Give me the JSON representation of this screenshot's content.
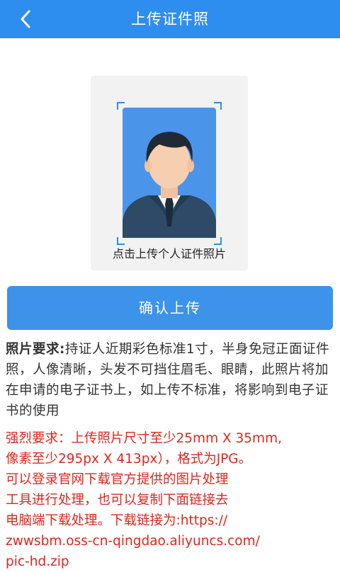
{
  "header": {
    "title": "上传证件照",
    "back_icon": "chevron-left-icon",
    "bg_color": "#2e8ef0"
  },
  "photo_card": {
    "caption": "点击上传个人证件照片",
    "portrait_icon": "person-portrait-icon",
    "portrait_bg_color": "#4a95ea"
  },
  "confirm_button": {
    "label": "确认上传",
    "color": "#3d92ea"
  },
  "requirements": {
    "label": "照片要求:",
    "text": "持证人近期彩色标准1寸，半身免冠正面证件照，人像清晰，头发不可挡住眉毛、眼睛，此照片将加在申请的电子证书上，如上传不标准，将影响到电子证书的使用"
  },
  "strong_requirements": {
    "color": "#e0261c",
    "lines": [
      "强烈要求：上传照片尺寸至少25mm X 35mm,",
      "像素至少295px X 413px），格式为JPG。",
      "可以登录官网下载官方提供的图片处理",
      "工具进行处理，也可以复制下面链接去",
      "电脑端下载处理。下载链接为:https://",
      "zwwsbm.oss-cn-qingdao.aliyuncs.com/",
      "pic-hd.zip"
    ]
  }
}
